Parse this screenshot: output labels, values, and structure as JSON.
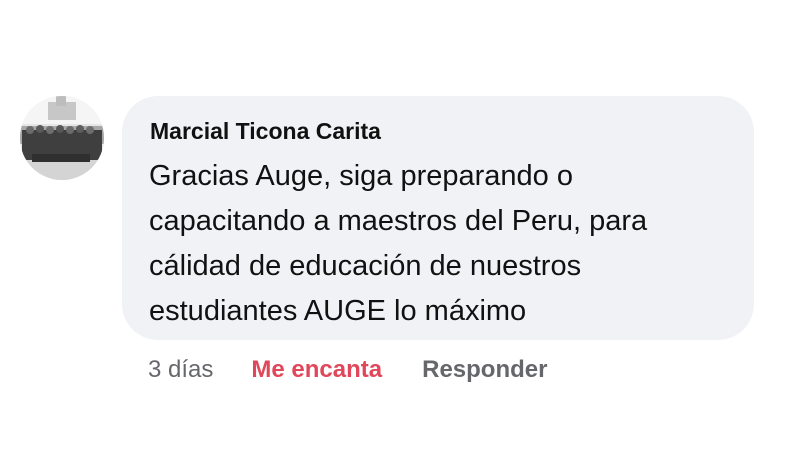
{
  "comment": {
    "avatar_icon": "profile-photo",
    "author": "Marcial Ticona Carita",
    "text": "Gracias Auge, siga preparando  o\ncapacitando a maestros del Peru, para\ncálidad de educación de nuestros\nestudiantes AUGE lo máximo",
    "timestamp": "3 días",
    "reaction_label": "Me encanta",
    "reply_label": "Responder",
    "colors": {
      "bubble": "#f0f2f5",
      "reaction": "#e0475a",
      "muted": "#65676b",
      "text": "#111111"
    }
  }
}
